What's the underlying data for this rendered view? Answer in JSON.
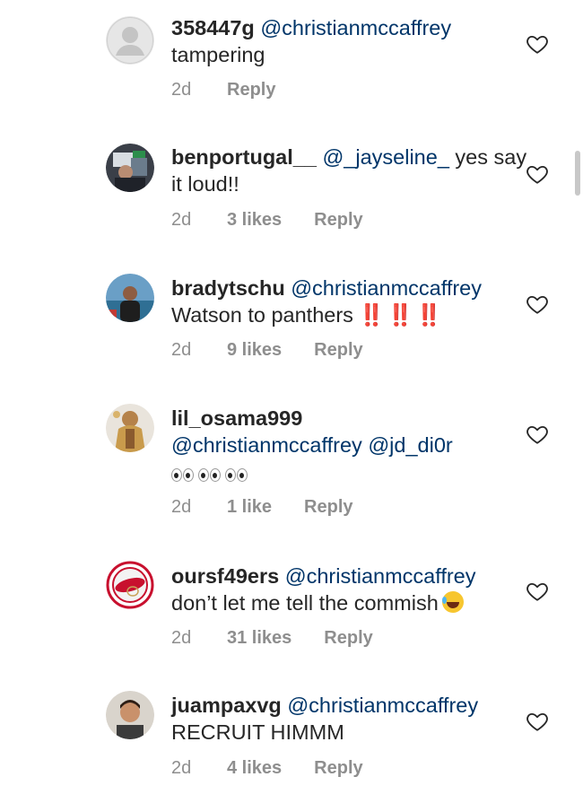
{
  "comments": [
    {
      "avatar": "default-avatar",
      "username": "358447g",
      "mentions": "@christianmccaffrey",
      "text": "tampering",
      "time": "2d",
      "likes": "",
      "reply": "Reply"
    },
    {
      "avatar": "user-photo",
      "username": "benportugal__",
      "mentions": "@_jayseline_",
      "text": "yes say it loud!!",
      "time": "2d",
      "likes": "3 likes",
      "reply": "Reply"
    },
    {
      "avatar": "user-photo",
      "username": "bradytschu",
      "mentions": "@christianmccaffrey",
      "text": "Watson to panthers",
      "emoji": "‼️ ‼️ ‼️",
      "time": "2d",
      "likes": "9 likes",
      "reply": "Reply"
    },
    {
      "avatar": "user-photo",
      "username": "lil_osama999",
      "mentions": "@christianmccaffrey @jd_di0r",
      "emoji": "👀👀👀",
      "time": "2d",
      "likes": "1 like",
      "reply": "Reply"
    },
    {
      "avatar": "logo-badge",
      "username": "oursf49ers",
      "mentions": "@christianmccaffrey",
      "text": "don’t let me tell the commish",
      "emoji": "😂",
      "time": "2d",
      "likes": "31 likes",
      "reply": "Reply"
    },
    {
      "avatar": "user-photo",
      "username": "juampaxvg",
      "mentions": "@christianmccaffrey",
      "text": "RECRUIT HIMMM",
      "time": "2d",
      "likes": "4 likes",
      "reply": "Reply"
    }
  ],
  "colors": {
    "text": "#262626",
    "mention": "#003569",
    "meta": "#8e8e8e",
    "alert_red": "#e0202a"
  },
  "icons": {
    "like": "heart-outline-icon"
  }
}
